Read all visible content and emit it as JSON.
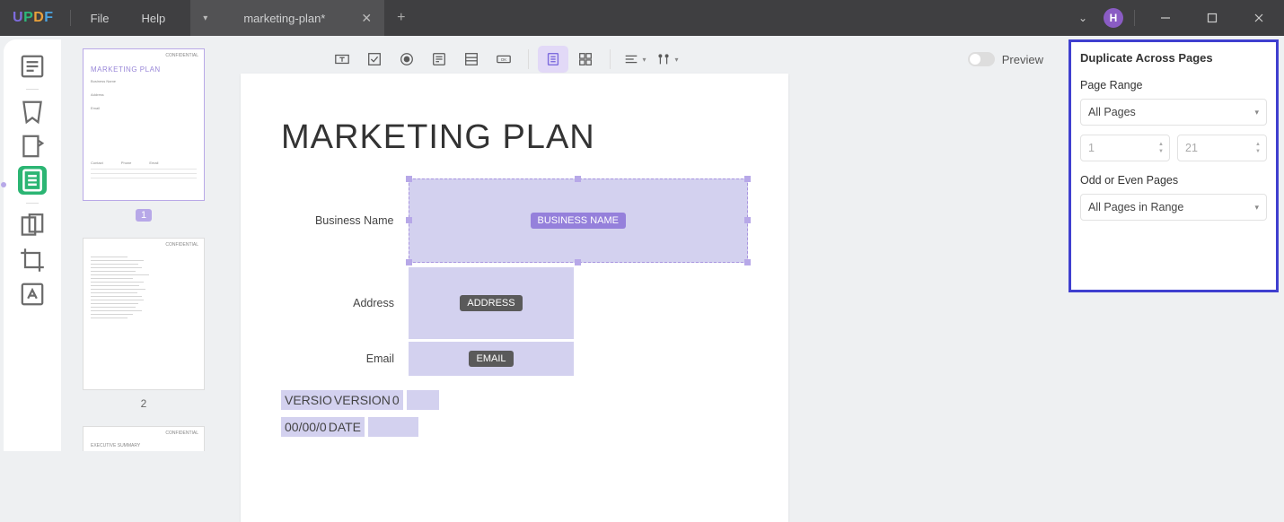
{
  "titlebar": {
    "logo": [
      "U",
      "P",
      "D",
      "F"
    ],
    "menu_file": "File",
    "menu_help": "Help",
    "tab_name": "marketing-plan*",
    "avatar_letter": "H"
  },
  "toolbar": {
    "preview_label": "Preview"
  },
  "thumbs": {
    "page1_title": "MARKETING PLAN",
    "page1_corner": "CONFIDENTIAL",
    "page1_num": "1",
    "page2_num": "2"
  },
  "document": {
    "title": "MARKETING PLAN",
    "labels": {
      "business": "Business Name",
      "address": "Address",
      "email": "Email"
    },
    "field_pills": {
      "business": "BUSINESS NAME",
      "address": "ADDRESS",
      "email": "EMAIL",
      "version": "VERSION",
      "date": "DATE"
    },
    "version_prefix": "VERSIO",
    "version_suffix": "0",
    "date_prefix": "00/00/0"
  },
  "panel": {
    "title": "Duplicate Across Pages",
    "page_range_label": "Page Range",
    "range_select": "All Pages",
    "from": "1",
    "to": "21",
    "odd_even_label": "Odd or Even Pages",
    "odd_even_select": "All Pages in Range"
  }
}
